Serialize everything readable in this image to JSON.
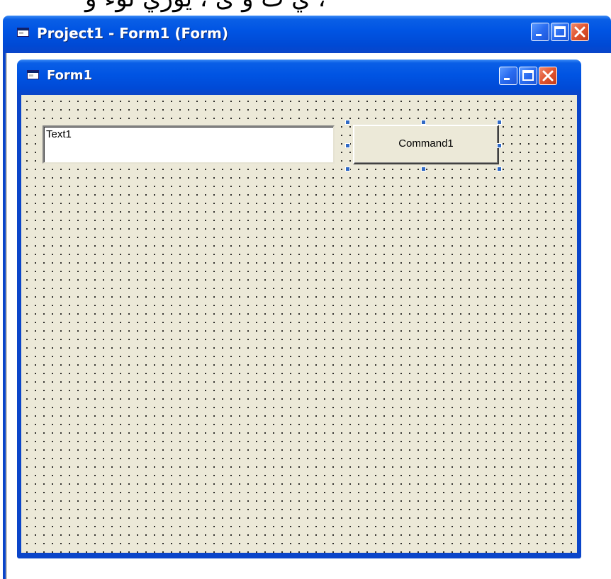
{
  "top_text": "ي ث و ئ ، يوري ئوء و ،",
  "outer_window": {
    "title": "Project1 - Form1 (Form)",
    "icon": "form-app-icon",
    "buttons": [
      "minimize-icon",
      "maximize-icon",
      "close-icon"
    ]
  },
  "form_window": {
    "title": "Form1",
    "icon": "form-app-icon",
    "buttons": [
      "minimize-icon",
      "maximize-icon",
      "close-icon"
    ]
  },
  "controls": {
    "textbox_value": "Text1",
    "command_label": "Command1"
  },
  "colors": {
    "titlebar": "#0054e3",
    "close_button": "#e0542f",
    "form_background": "#ece9d8",
    "selection_handle": "#316ac5"
  }
}
